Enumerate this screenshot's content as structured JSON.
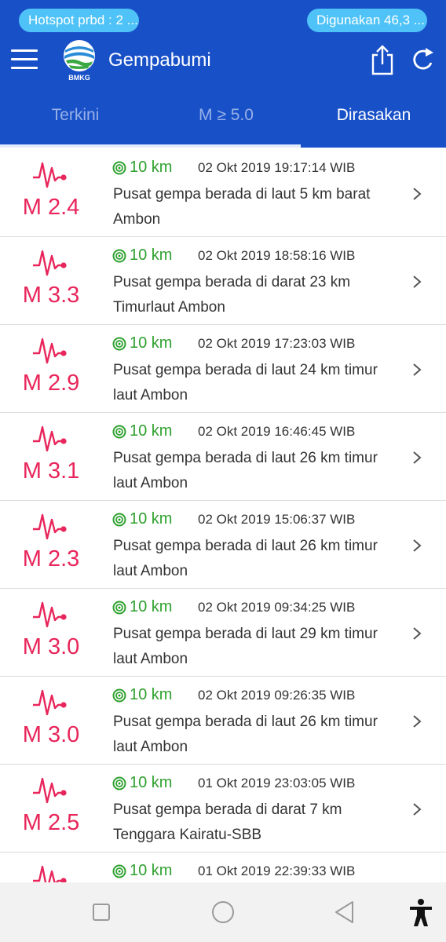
{
  "status_bar": {
    "hotspot_text": "Hotspot prbd : 2 ...",
    "usage_text": "Digunakan 46,3 ..."
  },
  "app_bar": {
    "logo_text": "BMKG",
    "title": "Gempabumi"
  },
  "tabs": [
    {
      "label": "Terkini",
      "active": false
    },
    {
      "label": "M ≥ 5.0",
      "active": false
    },
    {
      "label": "Dirasakan",
      "active": true
    }
  ],
  "quakes": [
    {
      "magnitude": "M 2.4",
      "depth": "10 km",
      "time": "02 Okt 2019 19:17:14 WIB",
      "description": "Pusat gempa berada di laut 5 km barat Ambon"
    },
    {
      "magnitude": "M 3.3",
      "depth": "10 km",
      "time": "02 Okt 2019 18:58:16 WIB",
      "description": "Pusat gempa berada di darat 23 km Timurlaut Ambon"
    },
    {
      "magnitude": "M 2.9",
      "depth": "10 km",
      "time": "02 Okt 2019 17:23:03 WIB",
      "description": "Pusat gempa berada di laut 24 km timur laut Ambon"
    },
    {
      "magnitude": "M 3.1",
      "depth": "10 km",
      "time": "02 Okt 2019 16:46:45 WIB",
      "description": "Pusat gempa berada di laut 26 km timur laut Ambon"
    },
    {
      "magnitude": "M 2.3",
      "depth": "10 km",
      "time": "02 Okt 2019 15:06:37 WIB",
      "description": "Pusat gempa berada di laut 26 km timur laut Ambon"
    },
    {
      "magnitude": "M 3.0",
      "depth": "10 km",
      "time": "02 Okt 2019 09:34:25 WIB",
      "description": "Pusat gempa berada di laut 29 km timur laut Ambon"
    },
    {
      "magnitude": "M 3.0",
      "depth": "10 km",
      "time": "02 Okt 2019 09:26:35 WIB",
      "description": "Pusat gempa berada di laut 26 km timur laut Ambon"
    },
    {
      "magnitude": "M 2.5",
      "depth": "10 km",
      "time": "01 Okt 2019 23:03:05 WIB",
      "description": "Pusat gempa berada di darat 7 km Tenggara Kairatu-SBB"
    },
    {
      "magnitude": "",
      "depth": "10 km",
      "time": "01 Okt 2019 22:39:33 WIB",
      "description": ""
    }
  ],
  "icons": {
    "menu": "hamburger-menu-icon",
    "share": "share-icon",
    "refresh": "refresh-icon",
    "quake": "seismograph-icon",
    "depth": "depth-target-icon",
    "chevron": "chevron-right-icon",
    "nav_recent": "square-icon",
    "nav_home": "circle-icon",
    "nav_back": "triangle-back-icon",
    "accessibility": "accessibility-icon"
  },
  "colors": {
    "primary": "#1850c8",
    "magnitude": "#e8265b",
    "depth": "#2fa12f",
    "pill": "#4fc3f7"
  }
}
